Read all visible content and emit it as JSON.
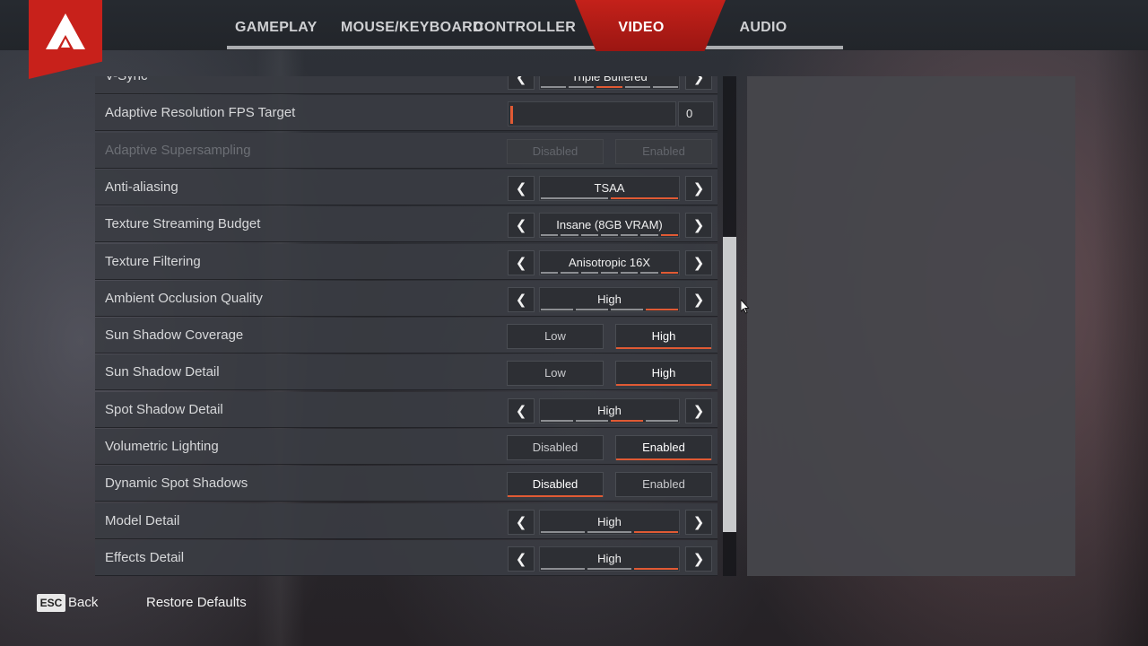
{
  "tabs": [
    {
      "label": "GAMEPLAY",
      "active": false
    },
    {
      "label": "MOUSE/KEYBOARD",
      "active": false
    },
    {
      "label": "CONTROLLER",
      "active": false
    },
    {
      "label": "VIDEO",
      "active": true
    },
    {
      "label": "AUDIO",
      "active": false
    }
  ],
  "colors": {
    "accent": "#e05a34",
    "brand_red": "#c8211b",
    "row_bg": "#3a3c42"
  },
  "settings": [
    {
      "label": "V-Sync",
      "type": "selector",
      "value": "Triple Buffered",
      "segments": 5,
      "selected_segment": 3
    },
    {
      "label": "Adaptive Resolution FPS Target",
      "type": "slider",
      "value": "0"
    },
    {
      "label": "Adaptive Supersampling",
      "type": "toggle",
      "options": [
        "Disabled",
        "Enabled"
      ],
      "selected": null,
      "disabled": true
    },
    {
      "label": "Anti-aliasing",
      "type": "selector",
      "value": "TSAA",
      "segments": 2,
      "selected_segment": 2
    },
    {
      "label": "Texture Streaming Budget",
      "type": "selector",
      "value": "Insane (8GB VRAM)",
      "segments": 7,
      "selected_segment": 7
    },
    {
      "label": "Texture Filtering",
      "type": "selector",
      "value": "Anisotropic 16X",
      "segments": 7,
      "selected_segment": 7
    },
    {
      "label": "Ambient Occlusion Quality",
      "type": "selector",
      "value": "High",
      "segments": 4,
      "selected_segment": 4
    },
    {
      "label": "Sun Shadow Coverage",
      "type": "toggle",
      "options": [
        "Low",
        "High"
      ],
      "selected": 1
    },
    {
      "label": "Sun Shadow Detail",
      "type": "toggle",
      "options": [
        "Low",
        "High"
      ],
      "selected": 1
    },
    {
      "label": "Spot Shadow Detail",
      "type": "selector",
      "value": "High",
      "segments": 4,
      "selected_segment": 3
    },
    {
      "label": "Volumetric Lighting",
      "type": "toggle",
      "options": [
        "Disabled",
        "Enabled"
      ],
      "selected": 1
    },
    {
      "label": "Dynamic Spot Shadows",
      "type": "toggle",
      "options": [
        "Disabled",
        "Enabled"
      ],
      "selected": 0
    },
    {
      "label": "Model Detail",
      "type": "selector",
      "value": "High",
      "segments": 3,
      "selected_segment": 3
    },
    {
      "label": "Effects Detail",
      "type": "selector",
      "value": "High",
      "segments": 3,
      "selected_segment": 3
    }
  ],
  "footer": {
    "esc_key": "ESC",
    "back_label": "Back",
    "restore_label": "Restore Defaults"
  },
  "icons": {
    "logo": "apex-logo",
    "left_arrow": "chevron-left-icon",
    "right_arrow": "chevron-right-icon"
  }
}
